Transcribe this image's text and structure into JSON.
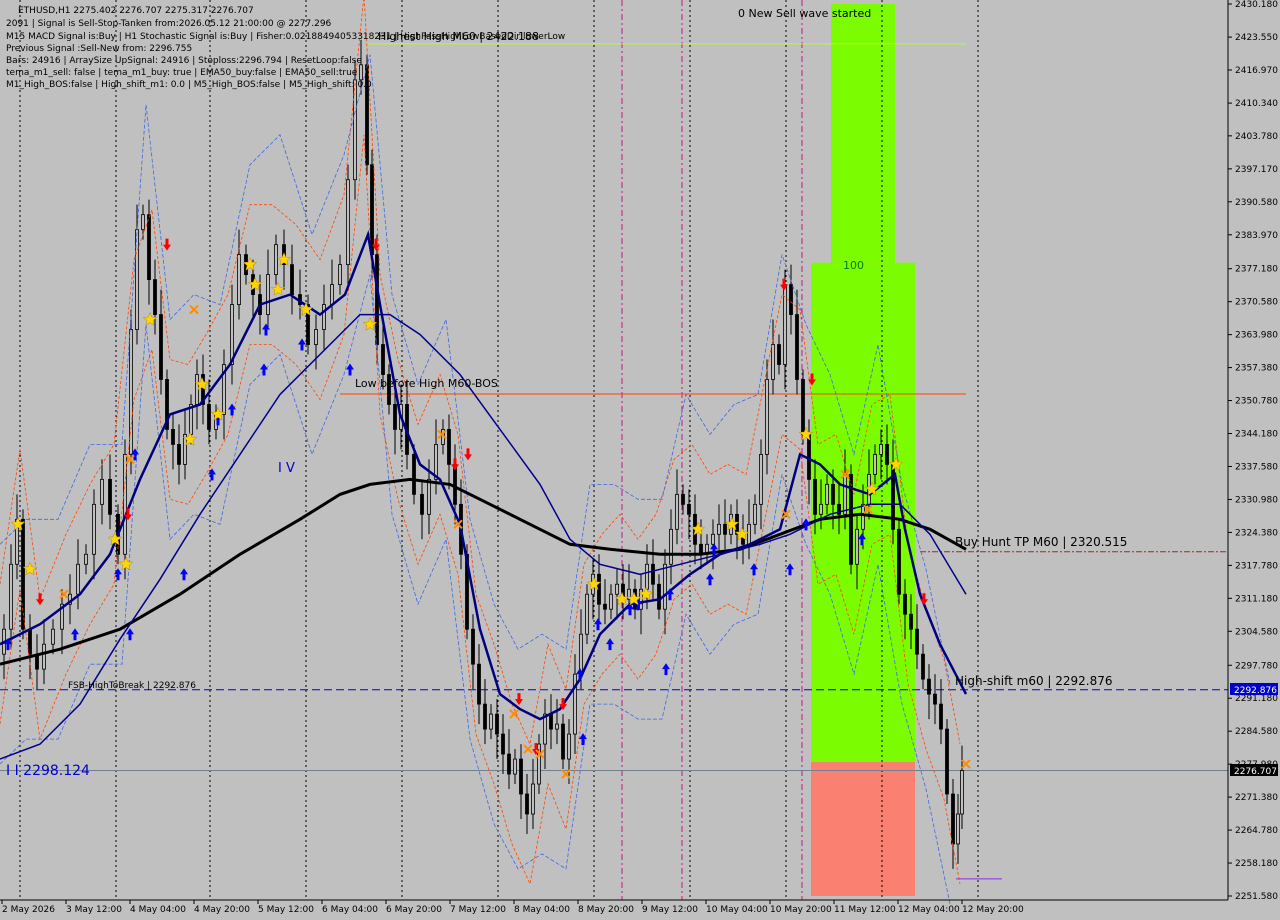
{
  "colors": {
    "background": "#c0c0c0",
    "candle": "#000000",
    "ma_fast": "#000080",
    "ma_mid": "#00008b",
    "ma_slow": "#000000",
    "band_orange": "#ff4500",
    "band_blue": "#4169e1",
    "zone_green": "#7cfc00",
    "zone_red": "#fa8072",
    "buy_arrow": "#0000ff",
    "sell_arrow": "#ff0000",
    "star": "#ffd700",
    "cross": "#ff8c00",
    "dashed_blue": "#0000cd",
    "price_box": "#000000"
  },
  "info_panel": {
    "lines": [
      "ETHUSD,H1  2275.402 2276.707 2275.317 2276.707",
      "2091 | Signal is Sell-Stop-Tanken from:2026.05.12 21:00:00 @ 2277.296",
      "M15 MACD Signal is:Buy | H1 Stochastic Signal is:Buy | Fisher:0.021884940533182​31 | HighPassHighLowBasedDir:lowerLow",
      "Previous Signal :Sell-New from: 2296.755",
      "Bars: 24916 | ArraySize UpSignal: 24916 | Stoploss:2296.794 | ResetLoop:false",
      "tema_m1_sell: false | tema_m1_buy: true | EMA50_buy:false | EMA50_sell:true",
      "M1_High_BOS:false | High_shift_m1: 0.0 | M5_High_BOS:false | M5_High_shift: 0.0"
    ]
  },
  "annotations": {
    "new_wave": "0 New Sell wave started",
    "highest_high": "Highest High   M60 | 2422.188",
    "low_before_high": "Low before High   M60-BOS",
    "zone_label": "100",
    "buy_hunt": "Buy Hunt TP M60 | 2320.515",
    "high_shift": "High-shift m60 | 2292.876",
    "fsb": "FSB-HighToBreak | 2292.876",
    "wave_iv": "I V",
    "wave_ii": "I I 2298.124"
  },
  "price_labels": {
    "high_shift": "2292.876",
    "current": "2276.707"
  },
  "chart_data": {
    "type": "candlestick",
    "symbol": "ETHUSD",
    "timeframe": "H1",
    "ylim": [
      2251.58,
      2430.18
    ],
    "y_ticks": [
      "2430.180",
      "2423.550",
      "2416.970",
      "2410.340",
      "2403.780",
      "2397.170",
      "2390.580",
      "2383.970",
      "2377.180",
      "2370.580",
      "2363.980",
      "2357.380",
      "2350.780",
      "2344.180",
      "2337.580",
      "2330.980",
      "2324.380",
      "2317.780",
      "2311.180",
      "2304.580",
      "2297.780",
      "2291.180",
      "2284.580",
      "2277.980",
      "2271.380",
      "2264.780",
      "2258.180",
      "2251.580"
    ],
    "x_ticks": [
      "2 May 2026",
      "3 May 12:00",
      "4 May 04:00",
      "4 May 20:00",
      "5 May 12:00",
      "6 May 04:00",
      "6 May 20:00",
      "7 May 12:00",
      "8 May 04:00",
      "8 May 20:00",
      "9 May 12:00",
      "10 May 04:00",
      "10 May 20:00",
      "11 May 12:00",
      "12 May 04:00",
      "12 May 20:00"
    ],
    "price_path": [
      [
        0,
        2300
      ],
      [
        8,
        2305
      ],
      [
        14,
        2318
      ],
      [
        20,
        2327
      ],
      [
        26,
        2305
      ],
      [
        34,
        2300
      ],
      [
        40,
        2297
      ],
      [
        48,
        2302
      ],
      [
        58,
        2305
      ],
      [
        66,
        2310
      ],
      [
        74,
        2312
      ],
      [
        82,
        2318
      ],
      [
        90,
        2320
      ],
      [
        98,
        2330
      ],
      [
        106,
        2335
      ],
      [
        114,
        2328
      ],
      [
        122,
        2320
      ],
      [
        128,
        2340
      ],
      [
        134,
        2365
      ],
      [
        140,
        2385
      ],
      [
        146,
        2388
      ],
      [
        152,
        2375
      ],
      [
        158,
        2368
      ],
      [
        164,
        2355
      ],
      [
        170,
        2345
      ],
      [
        176,
        2342
      ],
      [
        182,
        2338
      ],
      [
        188,
        2344
      ],
      [
        194,
        2350
      ],
      [
        200,
        2356
      ],
      [
        206,
        2350
      ],
      [
        212,
        2345
      ],
      [
        220,
        2348
      ],
      [
        228,
        2358
      ],
      [
        236,
        2370
      ],
      [
        242,
        2380
      ],
      [
        250,
        2376
      ],
      [
        256,
        2372
      ],
      [
        264,
        2368
      ],
      [
        272,
        2376
      ],
      [
        280,
        2382
      ],
      [
        288,
        2378
      ],
      [
        296,
        2372
      ],
      [
        304,
        2370
      ],
      [
        312,
        2362
      ],
      [
        320,
        2365
      ],
      [
        328,
        2370
      ],
      [
        336,
        2374
      ],
      [
        344,
        2378
      ],
      [
        352,
        2395
      ],
      [
        358,
        2415
      ],
      [
        364,
        2418
      ],
      [
        370,
        2398
      ],
      [
        374,
        2380
      ],
      [
        380,
        2362
      ],
      [
        386,
        2356
      ],
      [
        392,
        2350
      ],
      [
        398,
        2345
      ],
      [
        404,
        2350
      ],
      [
        410,
        2340
      ],
      [
        418,
        2332
      ],
      [
        426,
        2328
      ],
      [
        432,
        2335
      ],
      [
        440,
        2342
      ],
      [
        446,
        2345
      ],
      [
        452,
        2338
      ],
      [
        458,
        2330
      ],
      [
        464,
        2320
      ],
      [
        470,
        2305
      ],
      [
        476,
        2298
      ],
      [
        482,
        2290
      ],
      [
        488,
        2285
      ],
      [
        494,
        2288
      ],
      [
        500,
        2284
      ],
      [
        506,
        2280
      ],
      [
        512,
        2276
      ],
      [
        518,
        2279
      ],
      [
        524,
        2272
      ],
      [
        530,
        2268
      ],
      [
        536,
        2274
      ],
      [
        542,
        2282
      ],
      [
        548,
        2288
      ],
      [
        554,
        2285
      ],
      [
        560,
        2286
      ],
      [
        566,
        2279
      ],
      [
        572,
        2284
      ],
      [
        578,
        2296
      ],
      [
        584,
        2304
      ],
      [
        590,
        2312
      ],
      [
        596,
        2316
      ],
      [
        602,
        2310
      ],
      [
        608,
        2309
      ],
      [
        614,
        2312
      ],
      [
        620,
        2314
      ],
      [
        626,
        2311
      ],
      [
        632,
        2313
      ],
      [
        638,
        2309
      ],
      [
        644,
        2313
      ],
      [
        650,
        2318
      ],
      [
        656,
        2314
      ],
      [
        662,
        2309
      ],
      [
        668,
        2318
      ],
      [
        674,
        2325
      ],
      [
        680,
        2332
      ],
      [
        686,
        2330
      ],
      [
        692,
        2328
      ],
      [
        698,
        2322
      ],
      [
        704,
        2320
      ],
      [
        710,
        2322
      ],
      [
        716,
        2324
      ],
      [
        722,
        2326
      ],
      [
        728,
        2324
      ],
      [
        734,
        2328
      ],
      [
        740,
        2324
      ],
      [
        746,
        2322
      ],
      [
        752,
        2326
      ],
      [
        758,
        2330
      ],
      [
        764,
        2340
      ],
      [
        770,
        2355
      ],
      [
        776,
        2362
      ],
      [
        782,
        2358
      ],
      [
        788,
        2374
      ],
      [
        794,
        2368
      ],
      [
        800,
        2355
      ],
      [
        806,
        2344
      ],
      [
        812,
        2335
      ],
      [
        818,
        2328
      ],
      [
        824,
        2330
      ],
      [
        830,
        2334
      ],
      [
        836,
        2330
      ],
      [
        842,
        2328
      ],
      [
        848,
        2336
      ],
      [
        854,
        2318
      ],
      [
        860,
        2325
      ],
      [
        866,
        2330
      ],
      [
        872,
        2336
      ],
      [
        878,
        2340
      ],
      [
        884,
        2342
      ],
      [
        890,
        2338
      ],
      [
        896,
        2325
      ],
      [
        902,
        2312
      ],
      [
        908,
        2308
      ],
      [
        914,
        2305
      ],
      [
        920,
        2300
      ],
      [
        926,
        2295
      ],
      [
        932,
        2292
      ],
      [
        938,
        2290
      ],
      [
        944,
        2285
      ],
      [
        950,
        2272
      ],
      [
        956,
        2262
      ],
      [
        960,
        2268
      ],
      [
        964,
        2276.7
      ]
    ],
    "ma_fast": [
      [
        0,
        2302
      ],
      [
        40,
        2306
      ],
      [
        80,
        2312
      ],
      [
        110,
        2320
      ],
      [
        140,
        2335
      ],
      [
        170,
        2348
      ],
      [
        200,
        2350
      ],
      [
        230,
        2358
      ],
      [
        260,
        2370
      ],
      [
        290,
        2372
      ],
      [
        320,
        2368
      ],
      [
        345,
        2372
      ],
      [
        368,
        2384
      ],
      [
        380,
        2370
      ],
      [
        400,
        2348
      ],
      [
        420,
        2338
      ],
      [
        440,
        2335
      ],
      [
        460,
        2326
      ],
      [
        480,
        2305
      ],
      [
        500,
        2292
      ],
      [
        520,
        2289
      ],
      [
        540,
        2287
      ],
      [
        560,
        2289
      ],
      [
        580,
        2295
      ],
      [
        600,
        2304
      ],
      [
        630,
        2310
      ],
      [
        660,
        2311
      ],
      [
        690,
        2316
      ],
      [
        720,
        2320
      ],
      [
        750,
        2322
      ],
      [
        780,
        2325
      ],
      [
        800,
        2340
      ],
      [
        820,
        2338
      ],
      [
        840,
        2334
      ],
      [
        870,
        2332
      ],
      [
        895,
        2336
      ],
      [
        905,
        2325
      ],
      [
        920,
        2312
      ],
      [
        940,
        2302
      ],
      [
        966,
        2292
      ]
    ],
    "ma_mid": [
      [
        0,
        2279
      ],
      [
        40,
        2282
      ],
      [
        80,
        2290
      ],
      [
        120,
        2303
      ],
      [
        160,
        2315
      ],
      [
        200,
        2328
      ],
      [
        240,
        2340
      ],
      [
        280,
        2352
      ],
      [
        320,
        2360
      ],
      [
        360,
        2368
      ],
      [
        390,
        2368
      ],
      [
        420,
        2364
      ],
      [
        460,
        2356
      ],
      [
        500,
        2345
      ],
      [
        540,
        2334
      ],
      [
        570,
        2323
      ],
      [
        600,
        2318
      ],
      [
        640,
        2316
      ],
      [
        680,
        2318
      ],
      [
        720,
        2320
      ],
      [
        760,
        2322
      ],
      [
        790,
        2324
      ],
      [
        830,
        2328
      ],
      [
        870,
        2330
      ],
      [
        900,
        2330
      ],
      [
        930,
        2324
      ],
      [
        966,
        2312
      ]
    ],
    "ma_slow": [
      [
        0,
        2298
      ],
      [
        60,
        2301
      ],
      [
        120,
        2305
      ],
      [
        180,
        2312
      ],
      [
        240,
        2320
      ],
      [
        300,
        2327
      ],
      [
        340,
        2332
      ],
      [
        370,
        2334
      ],
      [
        410,
        2335
      ],
      [
        450,
        2334
      ],
      [
        490,
        2330
      ],
      [
        530,
        2326
      ],
      [
        570,
        2322
      ],
      [
        610,
        2321
      ],
      [
        660,
        2320
      ],
      [
        700,
        2320
      ],
      [
        740,
        2321
      ],
      [
        780,
        2324
      ],
      [
        820,
        2327
      ],
      [
        860,
        2328
      ],
      [
        900,
        2327
      ],
      [
        930,
        2325
      ],
      [
        966,
        2321
      ]
    ],
    "levels": [
      {
        "name": "highest-high",
        "value": 2422.188
      },
      {
        "name": "low-before-high",
        "value": 2352.1
      },
      {
        "name": "buy-hunt-tp",
        "value": 2320.515
      },
      {
        "name": "high-shift",
        "value": 2292.876
      },
      {
        "name": "current-price",
        "value": 2276.707
      }
    ],
    "zones": [
      {
        "name": "green-upper",
        "x0": 831,
        "x1": 895,
        "y0": 2430.18,
        "y1": 2378.4
      },
      {
        "name": "green-main",
        "x0": 811,
        "x1": 915,
        "y0": 2378.4,
        "y1": 2278.4
      },
      {
        "name": "red-lower",
        "x0": 811,
        "x1": 915,
        "y0": 2278.4,
        "y1": 2251.58
      }
    ],
    "buy_arrows": [
      [
        8,
        2302
      ],
      [
        75,
        2304
      ],
      [
        118,
        2316
      ],
      [
        130,
        2304
      ],
      [
        135,
        2340
      ],
      [
        184,
        2316
      ],
      [
        212,
        2336
      ],
      [
        218,
        2347
      ],
      [
        232,
        2349
      ],
      [
        264,
        2357
      ],
      [
        266,
        2365
      ],
      [
        302,
        2362
      ],
      [
        350,
        2357
      ],
      [
        580,
        2296
      ],
      [
        583,
        2283
      ],
      [
        598,
        2306
      ],
      [
        610,
        2302
      ],
      [
        630,
        2309
      ],
      [
        638,
        2310
      ],
      [
        666,
        2297
      ],
      [
        670,
        2312
      ],
      [
        710,
        2315
      ],
      [
        714,
        2321
      ],
      [
        754,
        2317
      ],
      [
        790,
        2317
      ],
      [
        806,
        2326
      ],
      [
        862,
        2323
      ]
    ],
    "sell_arrows": [
      [
        40,
        2311
      ],
      [
        128,
        2328
      ],
      [
        167,
        2382
      ],
      [
        376,
        2382
      ],
      [
        455,
        2338
      ],
      [
        468,
        2340
      ],
      [
        519,
        2291
      ],
      [
        536,
        2281
      ],
      [
        563,
        2290
      ],
      [
        784,
        2374
      ],
      [
        812,
        2355
      ],
      [
        924,
        2311
      ]
    ],
    "stars": [
      [
        18,
        2326
      ],
      [
        30,
        2317
      ],
      [
        115,
        2323
      ],
      [
        126,
        2318
      ],
      [
        150,
        2367
      ],
      [
        190,
        2343
      ],
      [
        202,
        2354
      ],
      [
        218,
        2348
      ],
      [
        250,
        2378
      ],
      [
        255,
        2374
      ],
      [
        278,
        2373
      ],
      [
        284,
        2379
      ],
      [
        306,
        2369
      ],
      [
        370,
        2366
      ],
      [
        698,
        2325
      ],
      [
        732,
        2326
      ],
      [
        742,
        2324
      ],
      [
        594,
        2314
      ],
      [
        622,
        2311
      ],
      [
        634,
        2311
      ],
      [
        646,
        2312
      ],
      [
        806,
        2344
      ],
      [
        872,
        2333
      ],
      [
        896,
        2338
      ]
    ],
    "crosses": [
      [
        64,
        2312
      ],
      [
        130,
        2339
      ],
      [
        194,
        2369
      ],
      [
        442,
        2344
      ],
      [
        458,
        2326
      ],
      [
        514,
        2288
      ],
      [
        528,
        2281
      ],
      [
        540,
        2280
      ],
      [
        566,
        2276
      ],
      [
        786,
        2328
      ],
      [
        845,
        2336
      ],
      [
        868,
        2329
      ],
      [
        966,
        2278
      ]
    ],
    "vlines_dotted": [
      20,
      116,
      210,
      306,
      402,
      498,
      594,
      690,
      786,
      882,
      978
    ],
    "vlines_dashdot": [
      622,
      682,
      802
    ]
  }
}
